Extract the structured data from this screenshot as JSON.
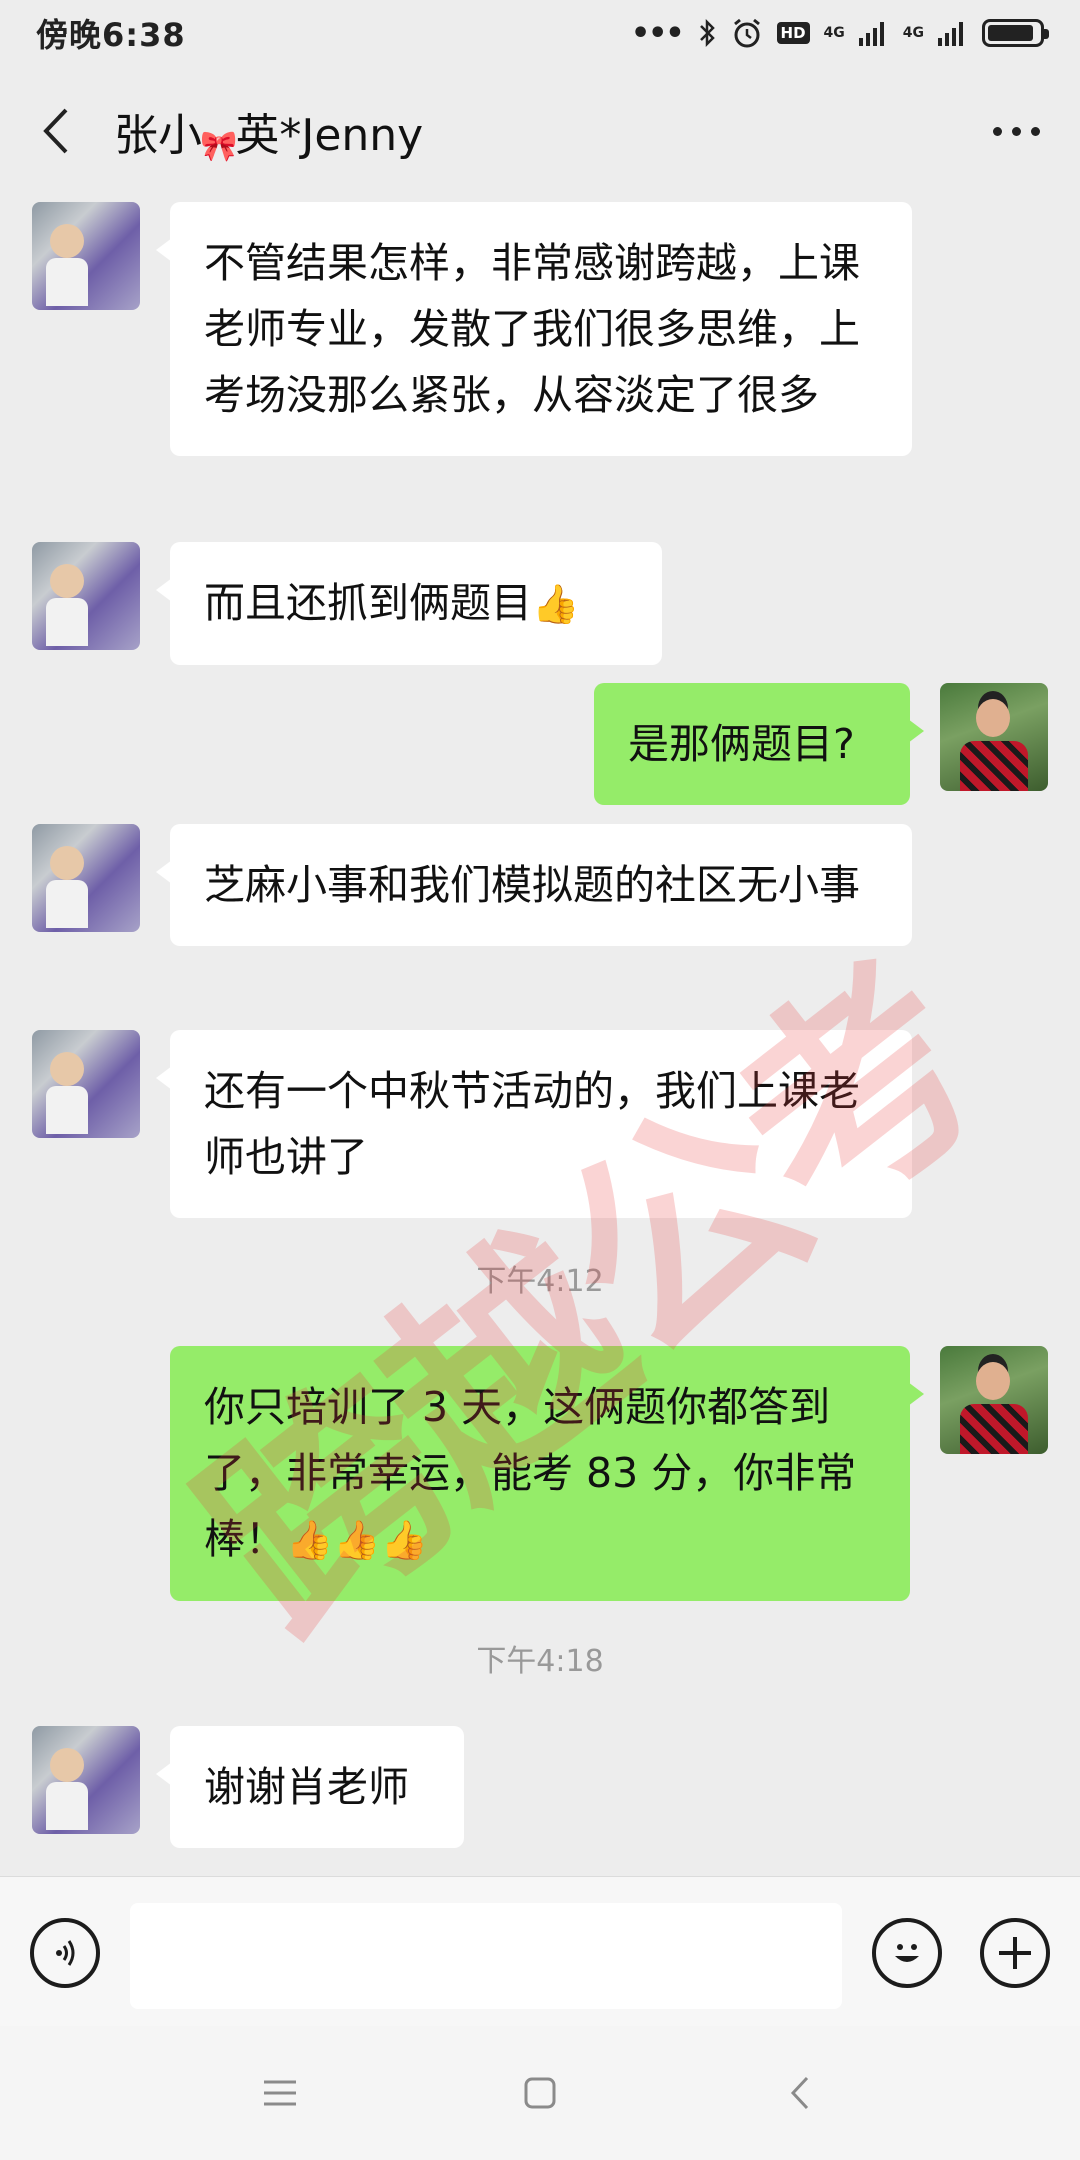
{
  "status_bar": {
    "time": "傍晚6:38",
    "hd": "HD",
    "net1": "4G",
    "net2": "4G"
  },
  "header": {
    "title_part1": "张小",
    "title_part2": "英*Jenny"
  },
  "messages": [
    {
      "side": "in",
      "text": "不管结果怎样，非常感谢跨越，上课老师专业，发散了我们很多思维，上考场没那么紧张，从容淡定了很多"
    },
    {
      "side": "in",
      "text": "而且还抓到俩题目",
      "emoji": "👍"
    },
    {
      "side": "out",
      "text": "是那俩题目?"
    },
    {
      "side": "in",
      "text": "芝麻小事和我们模拟题的社区无小事"
    },
    {
      "side": "in",
      "text": "还有一个中秋节活动的，我们上课老师也讲了"
    },
    {
      "type": "time",
      "text": "下午4:12"
    },
    {
      "side": "out",
      "text": "你只培训了 3 天，这俩题你都答到了，非常幸运，能考 83 分，你非常棒！",
      "emoji": "👍👍👍"
    },
    {
      "type": "time",
      "text": "下午4:18"
    },
    {
      "side": "in",
      "text": "谢谢肖老师"
    }
  ],
  "watermark": "跨越公考",
  "colors": {
    "incoming_bubble": "#ffffff",
    "outgoing_bubble": "#95ec69",
    "background": "#ededed",
    "watermark": "#e63c3c"
  },
  "icons": [
    "back-icon",
    "more-icon",
    "voice-icon",
    "emoji-icon",
    "plus-icon",
    "menu-icon",
    "home-icon",
    "nav-back-icon"
  ]
}
